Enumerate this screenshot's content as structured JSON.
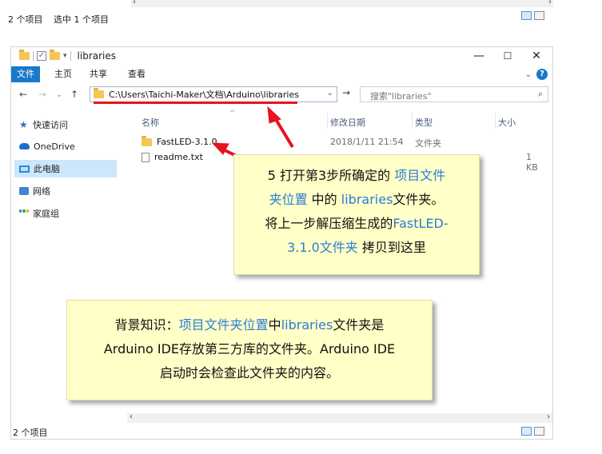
{
  "top": {
    "status_count": "2 个项目",
    "status_selected": "选中 1 个项目"
  },
  "window": {
    "title": "libraries",
    "controls": {
      "minimize": "—",
      "maximize": "☐",
      "close": "✕"
    }
  },
  "ribbon": {
    "tabs": [
      "文件",
      "主页",
      "共享",
      "查看"
    ]
  },
  "address": {
    "path": "C:\\Users\\Taichi-Maker\\文档\\Arduino\\libraries",
    "search_placeholder": "搜索\"libraries\""
  },
  "nav_pane": {
    "items": [
      {
        "label": "快速访问",
        "icon": "star-icon"
      },
      {
        "label": "OneDrive",
        "icon": "cloud-icon"
      },
      {
        "label": "此电脑",
        "icon": "computer-icon",
        "selected": true
      },
      {
        "label": "网络",
        "icon": "network-icon"
      },
      {
        "label": "家庭组",
        "icon": "homegroup-icon"
      }
    ]
  },
  "columns": {
    "name": "名称",
    "date": "修改日期",
    "type": "类型",
    "size": "大小"
  },
  "files": [
    {
      "name": "FastLED-3.1.0",
      "date": "2018/1/11 21:54",
      "type": "文件夹",
      "size": "",
      "icon": "folder-icon"
    },
    {
      "name": "readme.txt",
      "date": "",
      "type": "",
      "size": "1 KB",
      "icon": "text-file-icon"
    }
  ],
  "status_bar": {
    "count": "2 个项目"
  },
  "callout_step": {
    "l1a": "5 打开第3步所确定的 ",
    "l1b": "项目文件",
    "l2a": "夹位置",
    "l2b": " 中的 ",
    "l2c": "libraries",
    "l2d": "文件夹。",
    "l3a": "将上一步解压缩生成的",
    "l3b": "FastLED-",
    "l4a": "3.1.0文件夹",
    "l4b": " 拷贝到这里"
  },
  "callout_info": {
    "l1a": "背景知识：",
    "l1b": "项目文件夹位置",
    "l1c": "中",
    "l1d": "libraries",
    "l1e": "文件夹是",
    "l2": "Arduino IDE存放第三方库的文件夹。Arduino IDE",
    "l3": "启动时会检查此文件夹的内容。"
  },
  "colors": {
    "accent": "#1979ca",
    "highlight_text": "#2b7cd8",
    "callout_bg": "#ffffc7",
    "annotation_red": "#e6141e"
  }
}
